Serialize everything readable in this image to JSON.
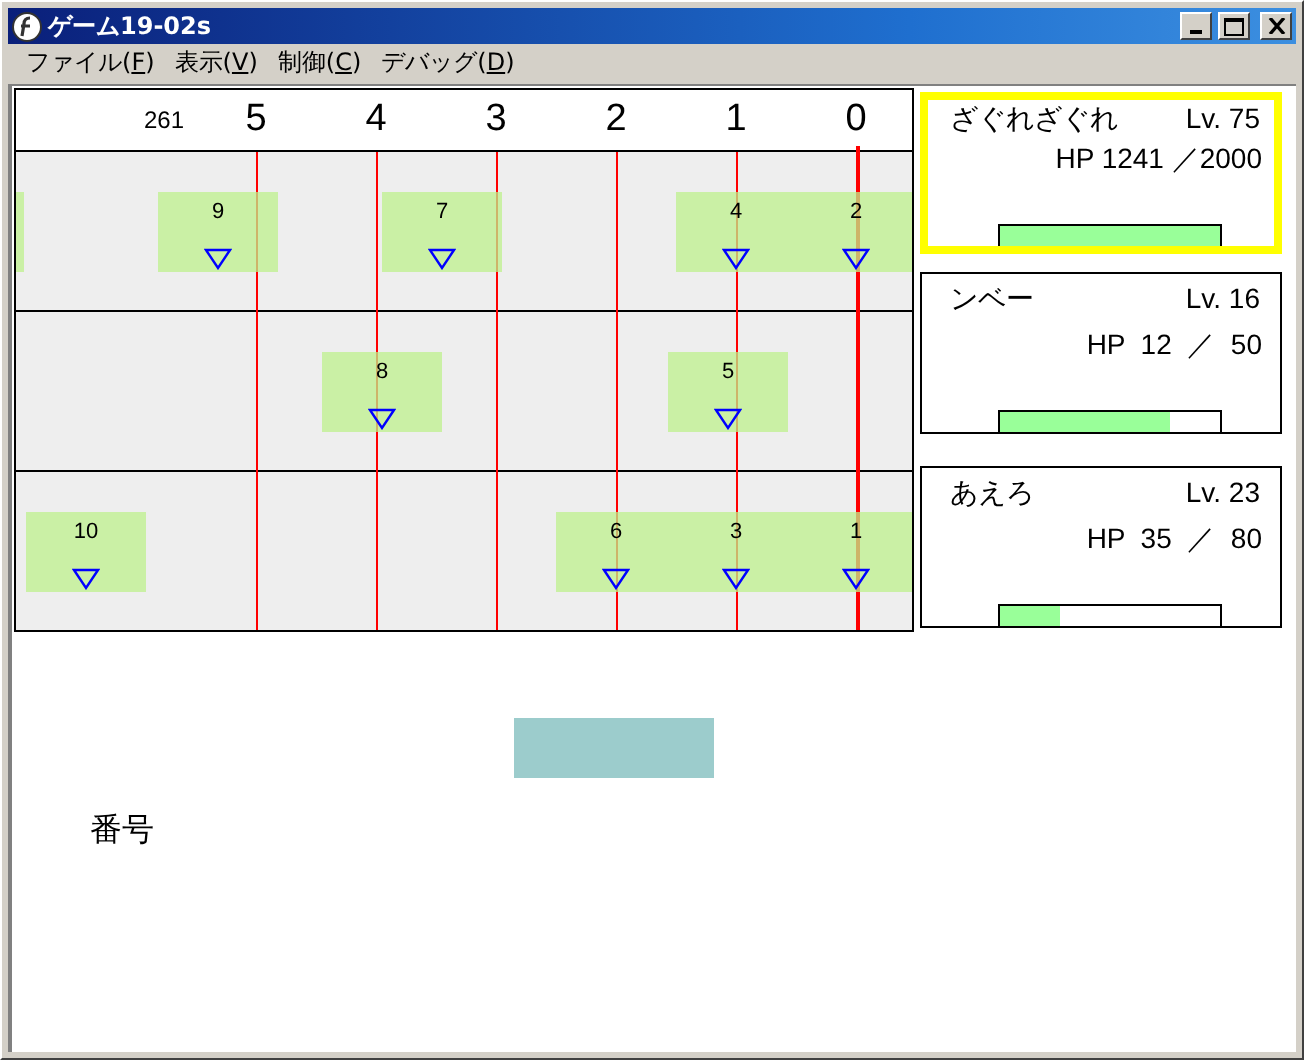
{
  "window": {
    "title": "ゲーム19-02s"
  },
  "menu": [
    {
      "before": "ファイル(",
      "key": "F",
      "after": ")"
    },
    {
      "before": "表示(",
      "key": "V",
      "after": ")"
    },
    {
      "before": "制御(",
      "key": "C",
      "after": ")"
    },
    {
      "before": "デバッグ(",
      "key": "D",
      "after": ")"
    }
  ],
  "timeline": {
    "counter": "261",
    "ticks": [
      "5",
      "4",
      "3",
      "2",
      "1",
      "0"
    ],
    "lanes": [
      {
        "markers": [
          {
            "kind": "clipped"
          },
          {
            "kind": "marker",
            "number": "9"
          },
          {
            "kind": "marker",
            "number": "7"
          },
          {
            "kind": "marker",
            "number": "4"
          },
          {
            "kind": "marker",
            "number": "2"
          }
        ]
      },
      {
        "markers": [
          {
            "kind": "marker",
            "number": "8"
          },
          {
            "kind": "marker",
            "number": "5"
          }
        ]
      },
      {
        "markers": [
          {
            "kind": "marker",
            "number": "10"
          },
          {
            "kind": "marker",
            "number": "6"
          },
          {
            "kind": "marker",
            "number": "3"
          },
          {
            "kind": "marker",
            "number": "1"
          }
        ]
      }
    ]
  },
  "units": [
    {
      "name": "ざぐれざぐれ",
      "lv": "Lv. 75",
      "hp": "HP 1241 ／2000",
      "level": 1.0,
      "selected": true
    },
    {
      "name": "ンベー",
      "lv": "Lv. 16",
      "hp": "HP  12  ／  50",
      "level": 0.77,
      "selected": false
    },
    {
      "name": "あえろ",
      "lv": "Lv. 23",
      "hp": "HP  35  ／  80",
      "level": 0.27,
      "selected": false
    }
  ],
  "footer": {
    "label": "番号"
  }
}
